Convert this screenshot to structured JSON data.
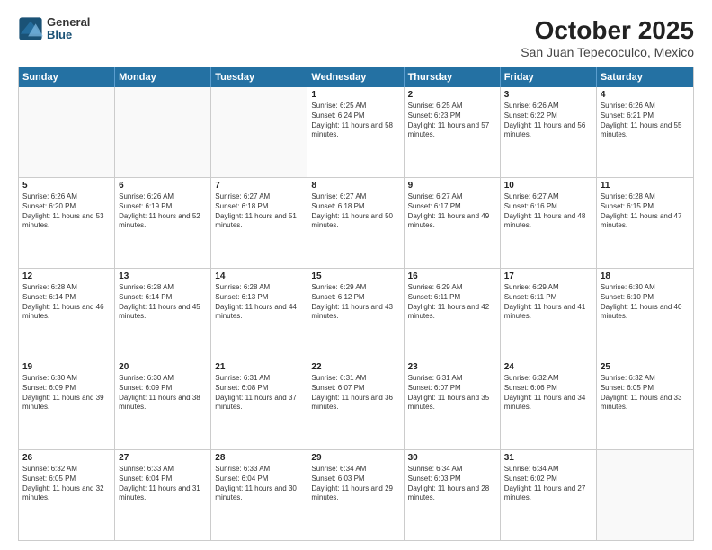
{
  "logo": {
    "general": "General",
    "blue": "Blue"
  },
  "title": "October 2025",
  "subtitle": "San Juan Tepecoculco, Mexico",
  "days": [
    "Sunday",
    "Monday",
    "Tuesday",
    "Wednesday",
    "Thursday",
    "Friday",
    "Saturday"
  ],
  "weeks": [
    [
      {
        "day": "",
        "sunrise": "",
        "sunset": "",
        "daylight": "",
        "empty": true
      },
      {
        "day": "",
        "sunrise": "",
        "sunset": "",
        "daylight": "",
        "empty": true
      },
      {
        "day": "",
        "sunrise": "",
        "sunset": "",
        "daylight": "",
        "empty": true
      },
      {
        "day": "1",
        "sunrise": "Sunrise: 6:25 AM",
        "sunset": "Sunset: 6:24 PM",
        "daylight": "Daylight: 11 hours and 58 minutes."
      },
      {
        "day": "2",
        "sunrise": "Sunrise: 6:25 AM",
        "sunset": "Sunset: 6:23 PM",
        "daylight": "Daylight: 11 hours and 57 minutes."
      },
      {
        "day": "3",
        "sunrise": "Sunrise: 6:26 AM",
        "sunset": "Sunset: 6:22 PM",
        "daylight": "Daylight: 11 hours and 56 minutes."
      },
      {
        "day": "4",
        "sunrise": "Sunrise: 6:26 AM",
        "sunset": "Sunset: 6:21 PM",
        "daylight": "Daylight: 11 hours and 55 minutes."
      }
    ],
    [
      {
        "day": "5",
        "sunrise": "Sunrise: 6:26 AM",
        "sunset": "Sunset: 6:20 PM",
        "daylight": "Daylight: 11 hours and 53 minutes."
      },
      {
        "day": "6",
        "sunrise": "Sunrise: 6:26 AM",
        "sunset": "Sunset: 6:19 PM",
        "daylight": "Daylight: 11 hours and 52 minutes."
      },
      {
        "day": "7",
        "sunrise": "Sunrise: 6:27 AM",
        "sunset": "Sunset: 6:18 PM",
        "daylight": "Daylight: 11 hours and 51 minutes."
      },
      {
        "day": "8",
        "sunrise": "Sunrise: 6:27 AM",
        "sunset": "Sunset: 6:18 PM",
        "daylight": "Daylight: 11 hours and 50 minutes."
      },
      {
        "day": "9",
        "sunrise": "Sunrise: 6:27 AM",
        "sunset": "Sunset: 6:17 PM",
        "daylight": "Daylight: 11 hours and 49 minutes."
      },
      {
        "day": "10",
        "sunrise": "Sunrise: 6:27 AM",
        "sunset": "Sunset: 6:16 PM",
        "daylight": "Daylight: 11 hours and 48 minutes."
      },
      {
        "day": "11",
        "sunrise": "Sunrise: 6:28 AM",
        "sunset": "Sunset: 6:15 PM",
        "daylight": "Daylight: 11 hours and 47 minutes."
      }
    ],
    [
      {
        "day": "12",
        "sunrise": "Sunrise: 6:28 AM",
        "sunset": "Sunset: 6:14 PM",
        "daylight": "Daylight: 11 hours and 46 minutes."
      },
      {
        "day": "13",
        "sunrise": "Sunrise: 6:28 AM",
        "sunset": "Sunset: 6:14 PM",
        "daylight": "Daylight: 11 hours and 45 minutes."
      },
      {
        "day": "14",
        "sunrise": "Sunrise: 6:28 AM",
        "sunset": "Sunset: 6:13 PM",
        "daylight": "Daylight: 11 hours and 44 minutes."
      },
      {
        "day": "15",
        "sunrise": "Sunrise: 6:29 AM",
        "sunset": "Sunset: 6:12 PM",
        "daylight": "Daylight: 11 hours and 43 minutes."
      },
      {
        "day": "16",
        "sunrise": "Sunrise: 6:29 AM",
        "sunset": "Sunset: 6:11 PM",
        "daylight": "Daylight: 11 hours and 42 minutes."
      },
      {
        "day": "17",
        "sunrise": "Sunrise: 6:29 AM",
        "sunset": "Sunset: 6:11 PM",
        "daylight": "Daylight: 11 hours and 41 minutes."
      },
      {
        "day": "18",
        "sunrise": "Sunrise: 6:30 AM",
        "sunset": "Sunset: 6:10 PM",
        "daylight": "Daylight: 11 hours and 40 minutes."
      }
    ],
    [
      {
        "day": "19",
        "sunrise": "Sunrise: 6:30 AM",
        "sunset": "Sunset: 6:09 PM",
        "daylight": "Daylight: 11 hours and 39 minutes."
      },
      {
        "day": "20",
        "sunrise": "Sunrise: 6:30 AM",
        "sunset": "Sunset: 6:09 PM",
        "daylight": "Daylight: 11 hours and 38 minutes."
      },
      {
        "day": "21",
        "sunrise": "Sunrise: 6:31 AM",
        "sunset": "Sunset: 6:08 PM",
        "daylight": "Daylight: 11 hours and 37 minutes."
      },
      {
        "day": "22",
        "sunrise": "Sunrise: 6:31 AM",
        "sunset": "Sunset: 6:07 PM",
        "daylight": "Daylight: 11 hours and 36 minutes."
      },
      {
        "day": "23",
        "sunrise": "Sunrise: 6:31 AM",
        "sunset": "Sunset: 6:07 PM",
        "daylight": "Daylight: 11 hours and 35 minutes."
      },
      {
        "day": "24",
        "sunrise": "Sunrise: 6:32 AM",
        "sunset": "Sunset: 6:06 PM",
        "daylight": "Daylight: 11 hours and 34 minutes."
      },
      {
        "day": "25",
        "sunrise": "Sunrise: 6:32 AM",
        "sunset": "Sunset: 6:05 PM",
        "daylight": "Daylight: 11 hours and 33 minutes."
      }
    ],
    [
      {
        "day": "26",
        "sunrise": "Sunrise: 6:32 AM",
        "sunset": "Sunset: 6:05 PM",
        "daylight": "Daylight: 11 hours and 32 minutes."
      },
      {
        "day": "27",
        "sunrise": "Sunrise: 6:33 AM",
        "sunset": "Sunset: 6:04 PM",
        "daylight": "Daylight: 11 hours and 31 minutes."
      },
      {
        "day": "28",
        "sunrise": "Sunrise: 6:33 AM",
        "sunset": "Sunset: 6:04 PM",
        "daylight": "Daylight: 11 hours and 30 minutes."
      },
      {
        "day": "29",
        "sunrise": "Sunrise: 6:34 AM",
        "sunset": "Sunset: 6:03 PM",
        "daylight": "Daylight: 11 hours and 29 minutes."
      },
      {
        "day": "30",
        "sunrise": "Sunrise: 6:34 AM",
        "sunset": "Sunset: 6:03 PM",
        "daylight": "Daylight: 11 hours and 28 minutes."
      },
      {
        "day": "31",
        "sunrise": "Sunrise: 6:34 AM",
        "sunset": "Sunset: 6:02 PM",
        "daylight": "Daylight: 11 hours and 27 minutes."
      },
      {
        "day": "",
        "sunrise": "",
        "sunset": "",
        "daylight": "",
        "empty": true
      }
    ]
  ]
}
